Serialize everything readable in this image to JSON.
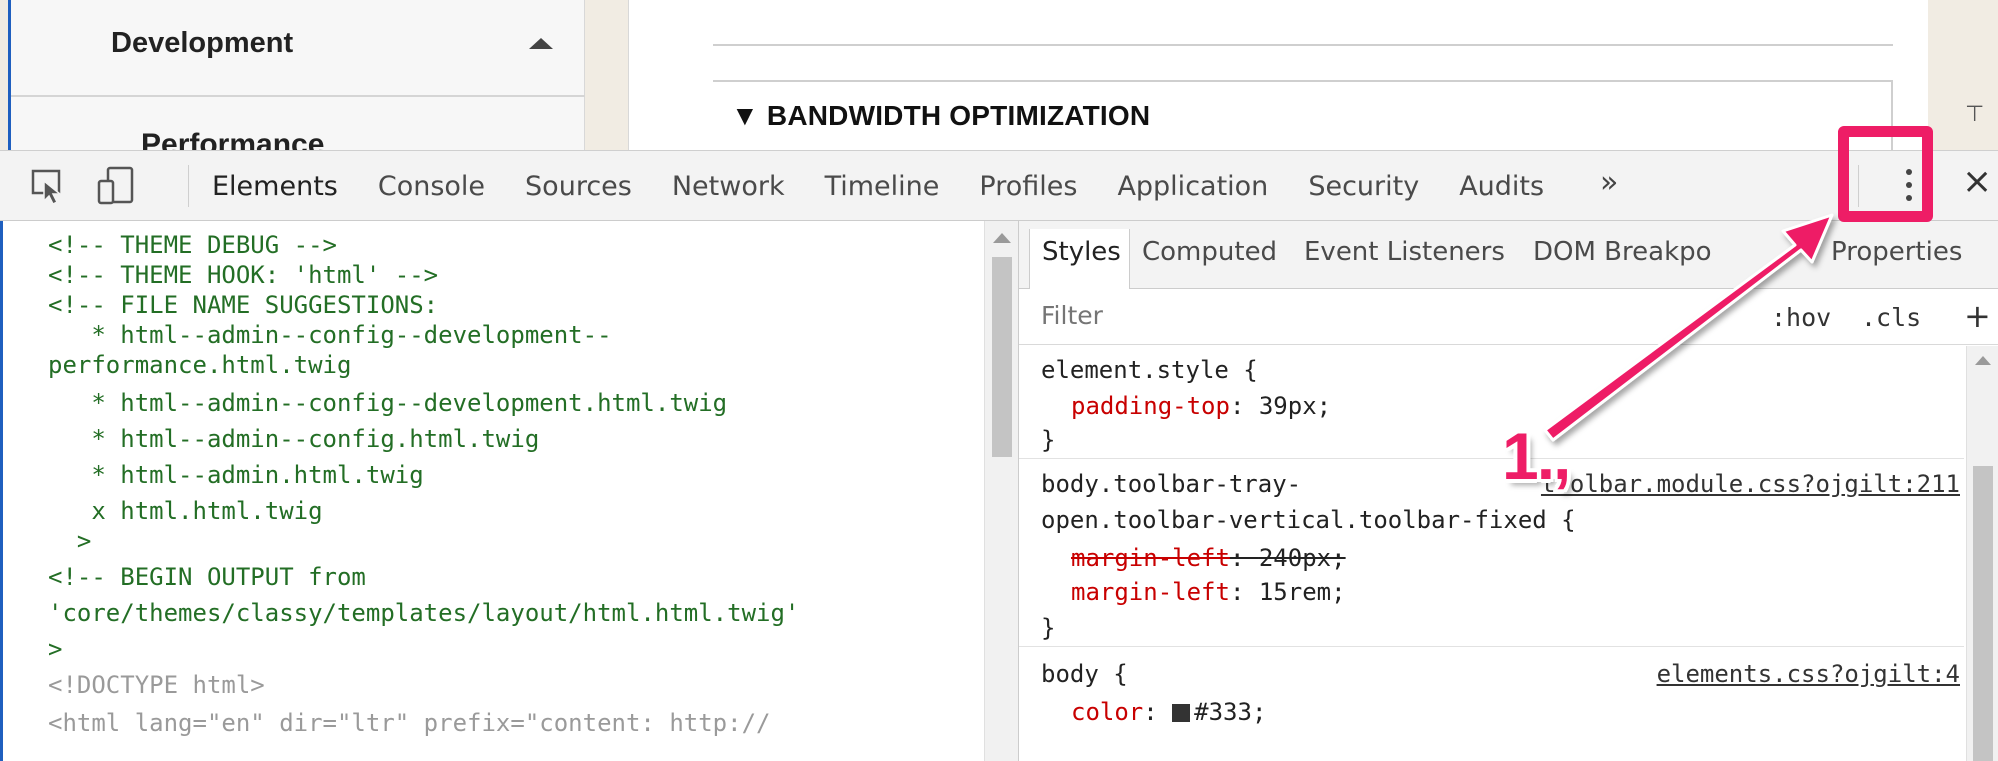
{
  "sidebar": {
    "development_label": "Development",
    "performance_label": "Performance"
  },
  "main": {
    "section_heading": "▼ BANDWIDTH OPTIMIZATION"
  },
  "devtools": {
    "tabs": [
      "Elements",
      "Console",
      "Sources",
      "Network",
      "Timeline",
      "Profiles",
      "Application",
      "Security",
      "Audits"
    ],
    "more_tabs_label": "»",
    "menu_icon": "kebab-menu-icon",
    "close_label": "×",
    "styles_subtabs": {
      "styles": "Styles",
      "computed": "Computed",
      "event_listeners": "Event Listeners",
      "dom_breakpoints": "DOM Breakpo",
      "properties": "Properties"
    },
    "filter_placeholder": "Filter",
    "hov_label": ":hov",
    "cls_label": ".cls",
    "add_label": "+",
    "elements_code": [
      "<!-- THEME DEBUG -->",
      "<!-- THEME HOOK: 'html' -->",
      "<!-- FILE NAME SUGGESTIONS:",
      "   * html--admin--config--development--",
      "performance.html.twig",
      "   * html--admin--config--development.html.twig",
      "   * html--admin--config.html.twig",
      "   * html--admin.html.twig",
      "   x html.html.twig",
      "  >",
      "<!-- BEGIN OUTPUT from",
      "'core/themes/classy/templates/layout/html.html.twig'",
      ">",
      "<!DOCTYPE html>",
      "<html lang=\"en\" dir=\"ltr\" prefix=\"content: http://"
    ],
    "styles_rules": {
      "element_style": {
        "selector": "element.style {",
        "prop": "padding-top",
        "value": "39px;",
        "close": "}"
      },
      "toolbar_rule": {
        "selector_line1": "body.toolbar-tray-",
        "selector_line2": "open.toolbar-vertical.toolbar-fixed {",
        "source": "toolbar.module.css?ojgilt:211",
        "struck_prop": "margin-left",
        "struck_value": "240px;",
        "prop": "margin-left",
        "value": "15rem;",
        "close": "}"
      },
      "body_rule": {
        "selector": "body {",
        "source": "elements.css?ojgilt:4",
        "prop": "color",
        "value": "#333;"
      }
    }
  },
  "annotation": {
    "step_label": "1.,",
    "color": "#ee1d66"
  }
}
